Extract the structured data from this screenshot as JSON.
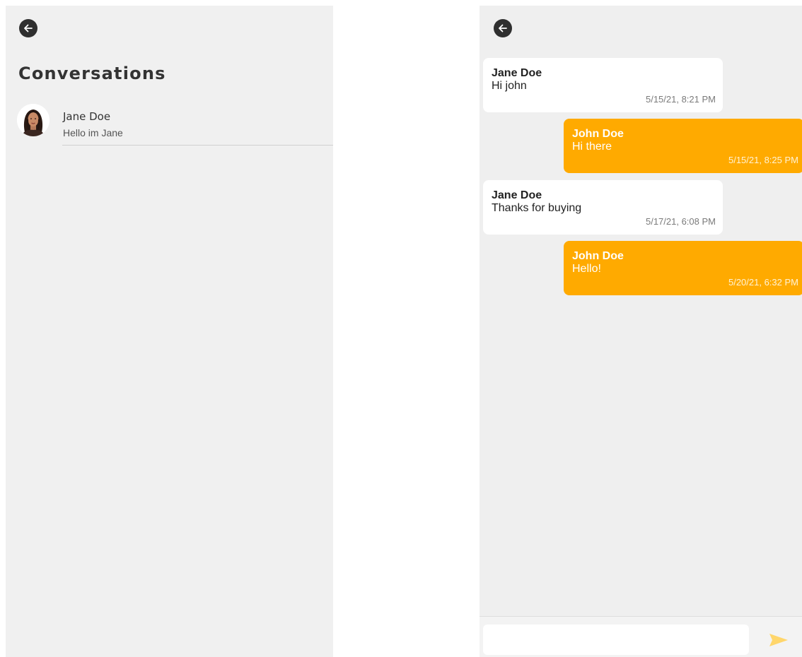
{
  "conversations": {
    "title": "Conversations",
    "items": [
      {
        "name": "Jane Doe",
        "preview": "Hello im Jane"
      }
    ]
  },
  "chat": {
    "messages": [
      {
        "sender": "Jane Doe",
        "text": "Hi john",
        "time": "5/15/21, 8:21 PM",
        "direction": "incoming"
      },
      {
        "sender": "John Doe",
        "text": "Hi there",
        "time": "5/15/21, 8:25 PM",
        "direction": "outgoing"
      },
      {
        "sender": "Jane Doe",
        "text": "Thanks for buying",
        "time": "5/17/21, 6:08 PM",
        "direction": "incoming"
      },
      {
        "sender": "John Doe",
        "text": "Hello!",
        "time": "5/20/21, 6:32 PM",
        "direction": "outgoing"
      }
    ],
    "composer": {
      "value": "",
      "placeholder": ""
    }
  },
  "icons": {
    "back": "arrow-left-icon",
    "send": "send-icon",
    "avatar": "avatar-photo"
  },
  "colors": {
    "accent": "#ffaa00",
    "send_icon": "#ffd66b",
    "panel_bg": "#f0f0f0",
    "back_button": "#2f2f2f"
  }
}
